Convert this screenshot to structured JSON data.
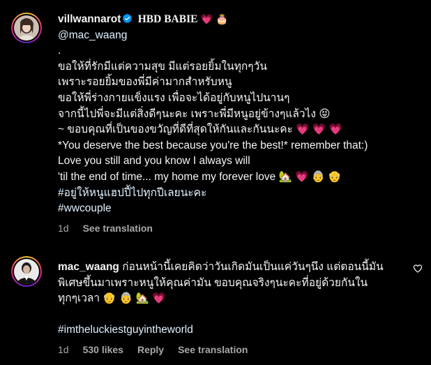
{
  "comment1": {
    "username": "villwannarot",
    "title_text": "HBD BABIE",
    "title_emojis": "💗 🎂",
    "mention": "@mac_waang",
    "lines": [
      ".",
      "ขอให้ที่รักมีแต่ความสุข มีแต่รอยยิ้มในทุกๆวัน",
      "เพราะรอยยิ้มของพี่มีค่ามากสำหรับหนู",
      "ขอให้พี่ร่างกายแข็งแรง เพื่อจะได้อยู่กับหนูไปนานๆ",
      "จากนี้ไปพี่จะมีแต่สิ่งดีๆนะคะ เพราะพี่มีหนูอยู่ข้างๆแล้วไง 😝",
      "~ ขอบคุณที่เป็นของขวัญที่ดีที่สุดให้กันและกันนะคะ 💗 💗 💗",
      "*You deserve the best because you're the best!* remember that:)",
      "Love you still and you know I always will",
      "'til the end of time... my home my forever love 🏡 💗 👵 👴"
    ],
    "hashtags": [
      "#อยู่ให้หนูแฮปปี้ไปทุกปีเลยนะคะ",
      "#wwcouple"
    ],
    "time": "1d",
    "see_translation": "See translation"
  },
  "comment2": {
    "username": "mac_waang",
    "text_lines": [
      "ก่อนหน้านี้เคยคิดว่าวันเกิดมันเป็นแค่วันๆนึง แต่ตอนนี้มัน",
      "พิเศษขึ้นมาเพราะหนูให้คุณค่ามัน ขอบคุณจริงๆนะคะที่อยู่ด้วยกันใน",
      "ทุกๆเวลา 👴 👵 🏡 💗"
    ],
    "hashtag": "#imtheluckiestguyintheworld",
    "time": "1d",
    "likes": "530 likes",
    "reply": "Reply",
    "see_translation": "See translation"
  }
}
